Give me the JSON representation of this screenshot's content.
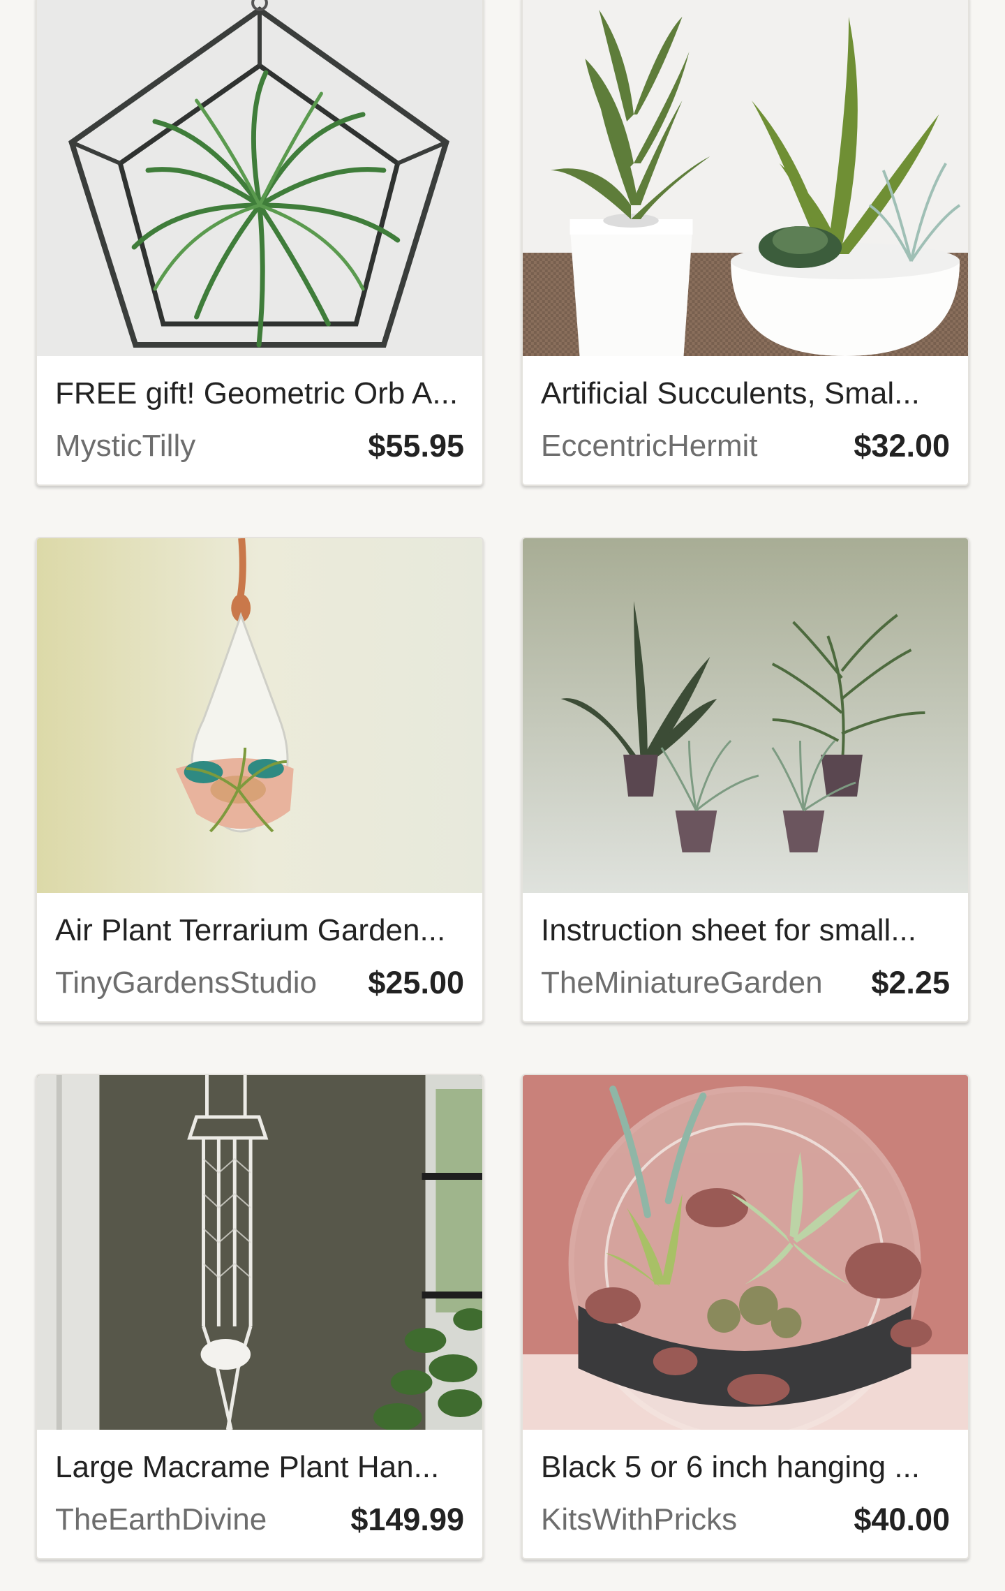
{
  "listings": [
    {
      "title": "FREE gift! Geometric Orb A...",
      "shop": "MysticTilly",
      "price": "$55.95",
      "image": "geometric-terrarium-air-plant"
    },
    {
      "title": "Artificial Succulents, Smal...",
      "shop": "EccentricHermit",
      "price": "$32.00",
      "image": "artificial-succulents-pots"
    },
    {
      "title": "Air Plant Terrarium Garden...",
      "shop": "TinyGardensStudio",
      "price": "$25.00",
      "image": "hanging-teardrop-terrarium"
    },
    {
      "title": "Instruction sheet for small...",
      "shop": "TheMiniatureGarden",
      "price": "$2.25",
      "image": "miniature-potted-plants"
    },
    {
      "title": "Large Macrame Plant Han...",
      "shop": "TheEarthDivine",
      "price": "$149.99",
      "image": "macrame-plant-hanger"
    },
    {
      "title": "Black 5 or 6 inch hanging ...",
      "shop": "KitsWithPricks",
      "price": "$40.00",
      "image": "glass-globe-succulent-terrarium"
    }
  ]
}
